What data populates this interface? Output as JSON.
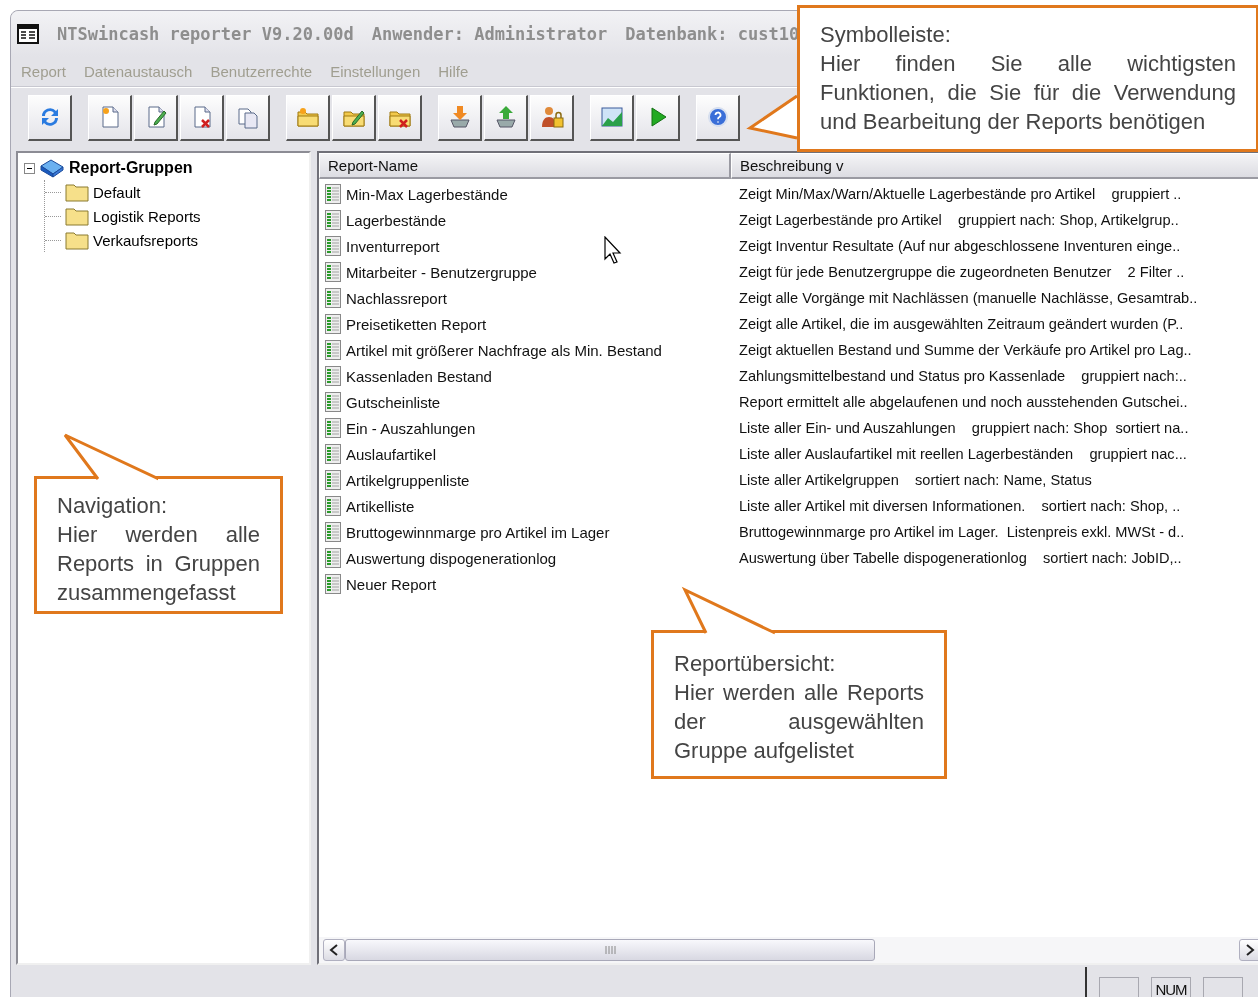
{
  "window": {
    "title_parts": [
      "NTSwincash reporter V9.20.00d",
      "Anwender: Administrator",
      "Datenbank: cust10"
    ]
  },
  "menu": [
    "Report",
    "Datenaustausch",
    "Benutzerrechte",
    "Einstellungen",
    "Hilfe"
  ],
  "tree": {
    "label": "Report-Gruppen",
    "expanded": true,
    "children": [
      {
        "label": "Default"
      },
      {
        "label": "Logistik Reports"
      },
      {
        "label": "Verkaufsreports"
      }
    ]
  },
  "table": {
    "columns": [
      "Report-Name",
      "Beschreibung v"
    ],
    "rows": [
      {
        "name": "Min-Max Lagerbestände",
        "description": "Zeigt Min/Max/Warn/Aktuelle Lagerbestände pro Artikel    gruppiert .."
      },
      {
        "name": "Lagerbestände",
        "description": "Zeigt Lagerbestände pro Artikel    gruppiert nach: Shop, Artikelgrup.."
      },
      {
        "name": "Inventurreport",
        "description": "Zeigt Inventur Resultate (Auf nur abgeschlossene Inventuren einge.."
      },
      {
        "name": "Mitarbeiter - Benutzergruppe",
        "description": "Zeigt für jede Benutzergruppe die zugeordneten Benutzer    2 Filter .."
      },
      {
        "name": "Nachlassreport",
        "description": "Zeigt alle Vorgänge mit Nachlässen (manuelle Nachlässe, Gesamtrab.."
      },
      {
        "name": "Preisetiketten Report",
        "description": "Zeigt alle Artikel, die im ausgewählten Zeitraum geändert wurden (P.."
      },
      {
        "name": "Artikel mit größerer Nachfrage als Min. Bestand",
        "description": "Zeigt aktuellen Bestand und Summe der Verkäufe pro Artikel pro Lag.."
      },
      {
        "name": "Kassenladen Bestand",
        "description": "Zahlungsmittelbestand und Status pro Kassenlade    gruppiert nach:.."
      },
      {
        "name": "Gutscheinliste",
        "description": "Report ermittelt alle abgelaufenen und noch ausstehenden Gutschei.."
      },
      {
        "name": "Ein - Auszahlungen",
        "description": "Liste aller Ein- und Auszahlungen    gruppiert nach: Shop  sortiert na.."
      },
      {
        "name": "Auslaufartikel",
        "description": "Liste aller Auslaufartikel mit reellen Lagerbeständen    gruppiert nac..."
      },
      {
        "name": "Artikelgruppenliste",
        "description": "Liste aller Artikelgruppen    sortiert nach: Name, Status"
      },
      {
        "name": "Artikelliste",
        "description": "Liste aller Artikel mit diversen Informationen.    sortiert nach: Shop, .."
      },
      {
        "name": "Bruttogewinnmarge pro Artikel im Lager",
        "description": "Bruttogewinnmarge pro Artikel im Lager.  Listenpreis exkl. MWSt - d.."
      },
      {
        "name": "Auswertung dispogenerationlog",
        "description": "Auswertung über Tabelle dispogenerationlog    sortiert nach: JobID,.."
      },
      {
        "name": "Neuer Report"
      }
    ]
  },
  "status_bar": {
    "indicator": "NUM"
  },
  "callouts": [
    {
      "kind": "toolbar",
      "title": "Symbolleiste:",
      "text": "Hier finden Sie alle wichtigsten Funktionen, die Sie für die Verwendung und Bearbeitung der Reports benötigen"
    },
    {
      "kind": "navigation",
      "title": "Navigation:",
      "text": "Hier werden alle Reports in Gruppen zusammengefasst"
    },
    {
      "kind": "list",
      "title": "Reportübersicht:",
      "text": "Hier werden alle Reports der ausgewählten Gruppe aufgelistet"
    }
  ]
}
